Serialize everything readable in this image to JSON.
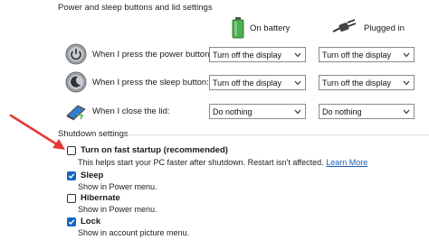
{
  "power_section": {
    "title": "Power and sleep buttons and lid settings",
    "on_battery_label": "On battery",
    "plugged_in_label": "Plugged in",
    "rows": [
      {
        "label": "When I press the power button:",
        "battery_value": "Turn off the display",
        "plugged_value": "Turn off the display",
        "icon": "power-icon"
      },
      {
        "label": "When I press the sleep button:",
        "battery_value": "Turn off the display",
        "plugged_value": "Turn off the display",
        "icon": "sleep-icon"
      },
      {
        "label": "When I close the lid:",
        "battery_value": "Do nothing",
        "plugged_value": "Do nothing",
        "icon": "laptop-lid-icon"
      }
    ]
  },
  "shutdown_section": {
    "title": "Shutdown settings",
    "items": [
      {
        "label": "Turn on fast startup (recommended)",
        "checked": false,
        "description": "This helps start your PC faster after shutdown. Restart isn't affected.",
        "link": "Learn More"
      },
      {
        "label": "Sleep",
        "checked": true,
        "description": "Show in Power menu."
      },
      {
        "label": "Hibernate",
        "checked": false,
        "description": "Show in Power menu."
      },
      {
        "label": "Lock",
        "checked": true,
        "description": "Show in account picture menu."
      }
    ]
  },
  "colors": {
    "accent": "#1565c0",
    "annotation_arrow": "#e53935",
    "link": "#1a5fb4"
  }
}
